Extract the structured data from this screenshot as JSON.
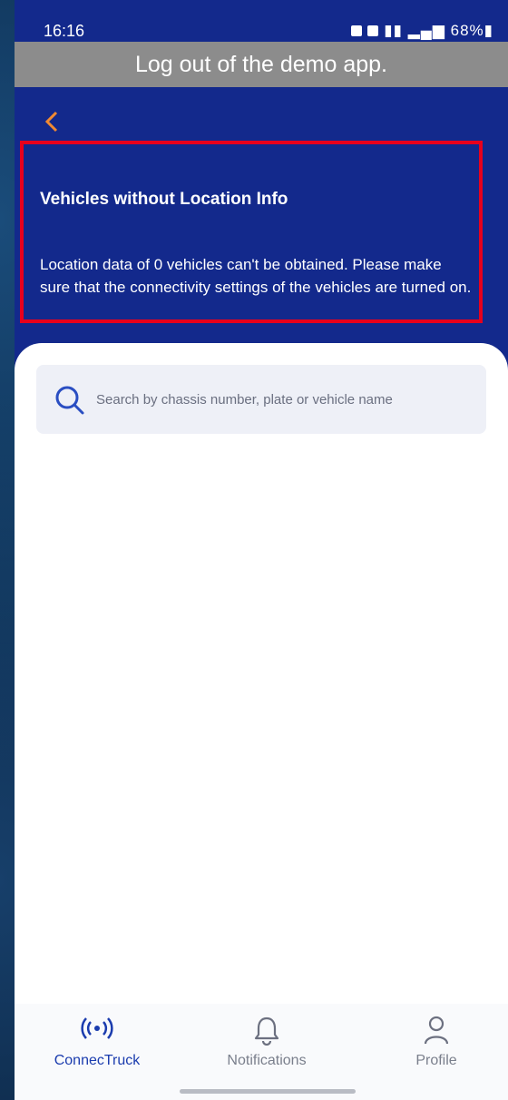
{
  "status_bar": {
    "time": "16:16",
    "battery": "68%"
  },
  "banner": {
    "text": "Log out of the demo app."
  },
  "info": {
    "title": "Vehicles without Location Info",
    "body": "Location data of 0 vehicles can't be obtained. Please make sure that the connectivity settings of the vehicles are turned on."
  },
  "search": {
    "placeholder": "Search by chassis number, plate or vehicle name"
  },
  "tabs": [
    {
      "label": "ConnecTruck",
      "icon": "connectruck-icon",
      "active": true
    },
    {
      "label": "Notifications",
      "icon": "bell-icon",
      "active": false
    },
    {
      "label": "Profile",
      "icon": "profile-icon",
      "active": false
    }
  ],
  "colors": {
    "header_bg": "#13298c",
    "banner_bg": "#8c8c8c",
    "highlight": "#e8001c",
    "accent": "#1b3cae"
  }
}
